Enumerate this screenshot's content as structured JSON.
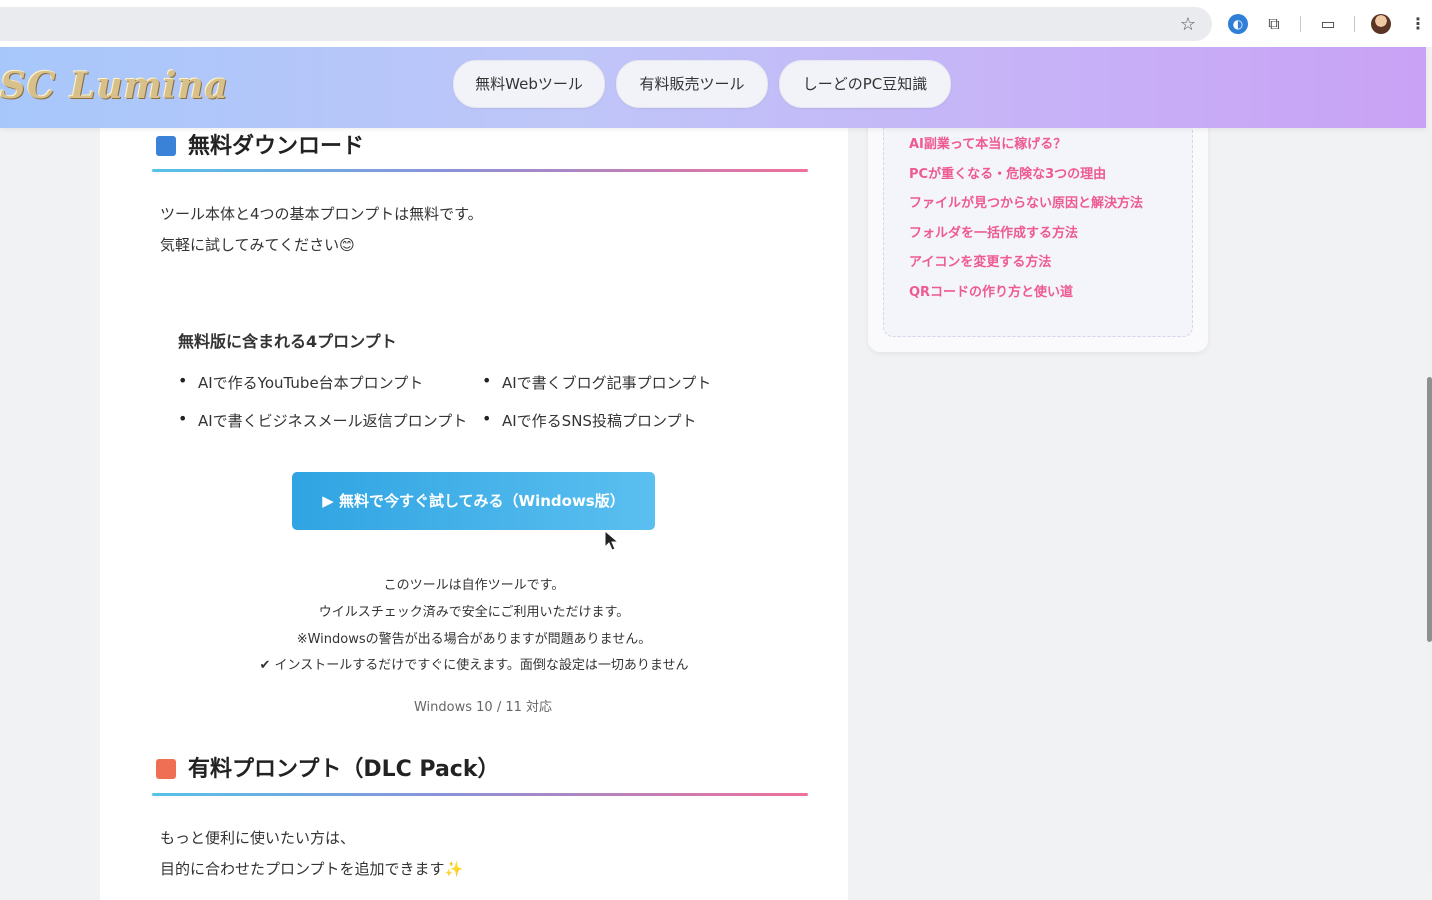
{
  "browser": {
    "icons": [
      "star-icon",
      "globe-icon",
      "puzzle-icon",
      "media-icon",
      "profile-icon",
      "menu-icon"
    ]
  },
  "header": {
    "logo": "SC Lumina",
    "nav": [
      "無料Webツール",
      "有料販売ツール",
      "しーどのPC豆知識"
    ]
  },
  "sidebar": {
    "links": [
      "AI副業って本当に稼げる？",
      "PCが重くなる・危険な3つの理由",
      "ファイルが見つからない原因と解決方法",
      "フォルダを一括作成する方法",
      "アイコンを変更する方法",
      "QRコードの作り方と使い道"
    ]
  },
  "free_section": {
    "heading": "無料ダウンロード",
    "intro_line1": "ツール本体と4つの基本プロンプトは無料です。",
    "intro_line2": "気軽に試してみてください😊",
    "subheading": "無料版に含まれる4プロンプト",
    "prompts": [
      "AIで作るYouTube台本プロンプト",
      "AIで書くブログ記事プロンプト",
      "AIで書くビジネスメール返信プロンプト",
      "AIで作るSNS投稿プロンプト"
    ],
    "button": "▶ 無料で今すぐ試してみる（Windows版）",
    "notes": [
      "このツールは自作ツールです。",
      "ウイルスチェック済みで安全にご利用いただけます。",
      "※Windowsの警告が出る場合がありますが問題ありません。",
      "✔ インストールするだけですぐに使えます。面倒な設定は一切ありません"
    ],
    "os_support": "Windows 10 / 11 対応"
  },
  "paid_section": {
    "heading": "有料プロンプト（DLC Pack）",
    "line1": "もっと便利に使いたい方は、",
    "line2": "目的に合わせたプロンプトを追加できます✨"
  },
  "colors": {
    "accent_blue": "#3a82d8",
    "accent_orange": "#ef6f55",
    "link_pink": "#ee5a92",
    "button_blue": "#2fa4e2"
  }
}
